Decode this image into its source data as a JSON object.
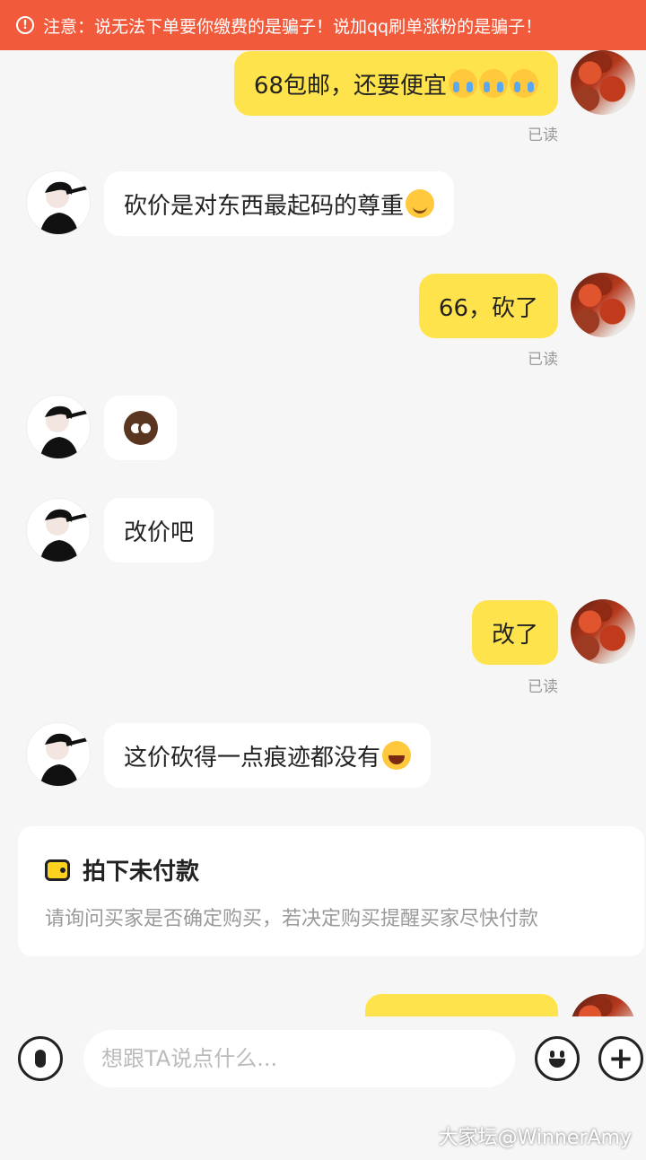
{
  "banner": {
    "icon": "exclamation-circle-icon",
    "text": "注意：说无法下单要你缴费的是骗子！说加qq刷单涨粉的是骗子！"
  },
  "messages": [
    {
      "from": "me",
      "text": "68包邮，还要便宜",
      "emoji": [
        "loudly-crying-face",
        "loudly-crying-face",
        "loudly-crying-face"
      ],
      "status": "已读"
    },
    {
      "from": "other",
      "text": "砍价是对东西最起码的尊重",
      "emoji": [
        "smirking-face"
      ]
    },
    {
      "from": "me",
      "text": "66，砍了",
      "status": "已读"
    },
    {
      "from": "other",
      "sticker": "crying-owl-sticker"
    },
    {
      "from": "other",
      "text": "改价吧"
    },
    {
      "from": "me",
      "text": "改了",
      "status": "已读"
    },
    {
      "from": "other",
      "text": "这价砍得一点痕迹都没有",
      "emoji": [
        "laughing-with-tears-face"
      ]
    }
  ],
  "order_card": {
    "icon": "wallet-icon",
    "title": "拍下未付款",
    "subtitle": "请询问买家是否确定购买，若决定购买提醒买家尽快付款"
  },
  "input_bar": {
    "placeholder": "想跟TA说点什么...",
    "value": "",
    "left_icon": "microphone-icon",
    "right_icons": [
      "emoji-icon",
      "plus-icon"
    ]
  },
  "watermark": "大家坛@WinnerAmy",
  "colors": {
    "banner": "#f15a3b",
    "my_bubble": "#ffe34d",
    "other_bubble": "#ffffff",
    "background": "#f6f6f6"
  }
}
